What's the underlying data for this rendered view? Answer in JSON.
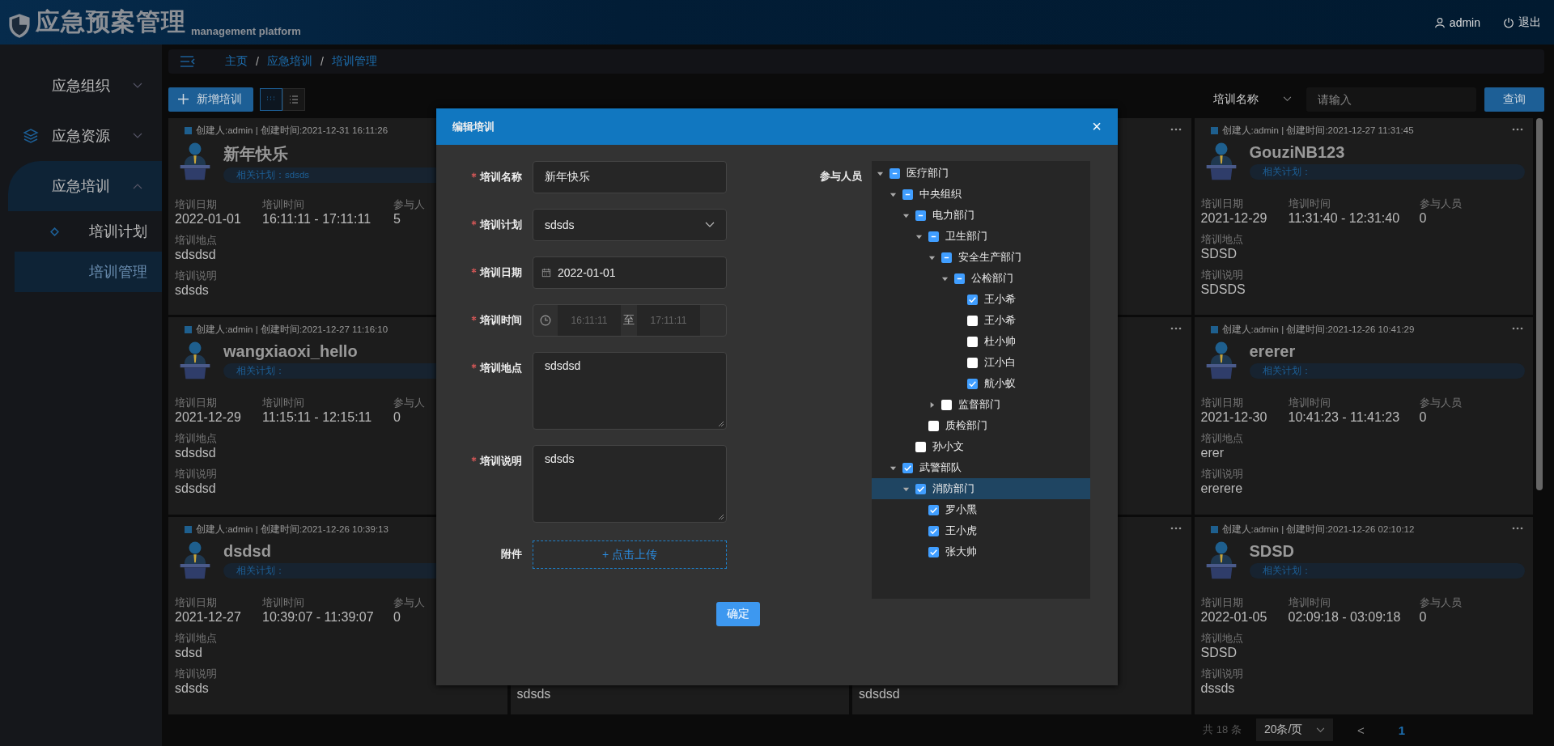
{
  "header": {
    "title": "应急预案管理",
    "subtitle": "management platform",
    "user": "admin",
    "logout": "退出"
  },
  "sidebar": {
    "items": [
      {
        "label": "应急组织",
        "icon": false,
        "expanded": false,
        "selected": false
      },
      {
        "label": "应急资源",
        "icon": true,
        "expanded": false,
        "selected": false
      },
      {
        "label": "应急培训",
        "icon": false,
        "expanded": true,
        "selected": true,
        "children": [
          {
            "label": "培训计划",
            "selected": false
          },
          {
            "label": "培训管理",
            "selected": true
          }
        ]
      }
    ]
  },
  "breadcrumb": {
    "separator": "/",
    "items": [
      "主页",
      "应急培训",
      "培训管理"
    ]
  },
  "toolbar": {
    "add_button": "新增培训",
    "views": [
      {
        "kind": "grid",
        "selected": true
      },
      {
        "kind": "list",
        "selected": false
      }
    ],
    "filter_field": "培训名称",
    "search": {
      "placeholder": "请输入"
    },
    "query_button": "查询"
  },
  "card_columns": [
    [
      {
        "meta": "创建人:admin | 创建时间:2021-12-31 16:11:26",
        "title": "新年快乐",
        "plan": "相关计划：sdsds",
        "stats": [
          {
            "label": "培训日期",
            "value": "2022-01-01"
          },
          {
            "label": "培训时间",
            "value": "16:11:11 - 17:11:11"
          },
          {
            "label": "参与人",
            "value": "5"
          }
        ],
        "place_label": "培训地点",
        "place": "sdsdsd",
        "desc_label": "培训说明",
        "desc": "sdsds"
      },
      {
        "meta": "创建人:admin | 创建时间:2021-12-27 11:16:10",
        "title": "wangxiaoxi_hello",
        "plan": "相关计划：",
        "stats": [
          {
            "label": "培训日期",
            "value": "2021-12-29"
          },
          {
            "label": "培训时间",
            "value": "11:15:11 - 12:15:11"
          },
          {
            "label": "参与人",
            "value": "0"
          }
        ],
        "place_label": "培训地点",
        "place": "sdsdsd",
        "desc_label": "培训说明",
        "desc": "sdsdsd"
      },
      {
        "meta": "创建人:admin | 创建时间:2021-12-26 10:39:13",
        "title": "dsdsd",
        "plan": "相关计划：",
        "stats": [
          {
            "label": "培训日期",
            "value": "2021-12-27"
          },
          {
            "label": "培训时间",
            "value": "10:39:07 - 11:39:07"
          },
          {
            "label": "参与人",
            "value": "0"
          }
        ],
        "place_label": "培训地点",
        "place": "sdsd",
        "desc_label": "培训说明",
        "desc": "sdsds"
      }
    ],
    [
      {
        "desc": "sdsds"
      }
    ],
    [
      {
        "menu": true
      },
      {
        "menu": true
      },
      {
        "desc": "sdsdsd",
        "menu": true
      }
    ],
    [
      {
        "meta": "创建人:admin | 创建时间:2021-12-27 11:31:45",
        "title": "GouziNB123",
        "plan": "相关计划：",
        "stats": [
          {
            "label": "培训日期",
            "value": "2021-12-29"
          },
          {
            "label": "培训时间",
            "value": "11:31:40 - 12:31:40"
          },
          {
            "label": "参与人员",
            "value": "0"
          }
        ],
        "place_label": "培训地点",
        "place": "SDSD",
        "desc_label": "培训说明",
        "desc": "SDSDS",
        "menu": true
      },
      {
        "meta": "创建人:admin | 创建时间:2021-12-26 10:41:29",
        "title": "ererer",
        "plan": "相关计划：",
        "stats": [
          {
            "label": "培训日期",
            "value": "2021-12-30"
          },
          {
            "label": "培训时间",
            "value": "10:41:23 - 11:41:23"
          },
          {
            "label": "参与人员",
            "value": "0"
          }
        ],
        "place_label": "培训地点",
        "place": "erer",
        "desc_label": "培训说明",
        "desc": "ererere",
        "menu": true
      },
      {
        "meta": "创建人:admin | 创建时间:2021-12-26 02:10:12",
        "title": "SDSD",
        "plan": "相关计划：",
        "stats": [
          {
            "label": "培训日期",
            "value": "2022-01-05"
          },
          {
            "label": "培训时间",
            "value": "02:09:18 - 03:09:18"
          },
          {
            "label": "参与人员",
            "value": "0"
          }
        ],
        "place_label": "培训地点",
        "place": "SDSD",
        "desc_label": "培训说明",
        "desc": "dssds",
        "menu": true
      }
    ]
  ],
  "pagination": {
    "total": "共 18 条",
    "page_size": "20条/页",
    "prev": "<",
    "pages": [
      {
        "label": "1",
        "selected": true
      }
    ]
  },
  "dialog": {
    "title": "编辑培训",
    "close": "×",
    "fields": [
      {
        "kind": "text",
        "label": "培训名称",
        "required": true,
        "value": "新年快乐"
      },
      {
        "kind": "select",
        "label": "培训计划",
        "required": true,
        "value": "sdsds"
      },
      {
        "kind": "date",
        "label": "培训日期",
        "required": true,
        "value": "2022-01-01"
      },
      {
        "kind": "timerange",
        "label": "培训时间",
        "required": true,
        "start": "16:11:11",
        "separator": "至",
        "end": "17:11:11"
      },
      {
        "kind": "textarea",
        "label": "培训地点",
        "required": true,
        "value": "sdsdsd"
      },
      {
        "kind": "textarea",
        "label": "培训说明",
        "required": true,
        "value": "sdsds"
      },
      {
        "kind": "upload",
        "label": "附件",
        "required": false,
        "value": "+ 点击上传"
      }
    ],
    "tree_label": "参与人员",
    "tree": [
      {
        "label": "医疗部门",
        "checked": false,
        "indeterminate": true,
        "expanded": true,
        "selected": false,
        "children": [
          {
            "label": "中央组织",
            "checked": false,
            "indeterminate": true,
            "expanded": true,
            "selected": false,
            "children": [
              {
                "label": "电力部门",
                "checked": false,
                "indeterminate": true,
                "expanded": true,
                "selected": false,
                "children": [
                  {
                    "label": "卫生部门",
                    "checked": false,
                    "indeterminate": true,
                    "expanded": true,
                    "selected": false,
                    "children": [
                      {
                        "label": "安全生产部门",
                        "checked": false,
                        "indeterminate": true,
                        "expanded": true,
                        "selected": false,
                        "children": [
                          {
                            "label": "公检部门",
                            "checked": false,
                            "indeterminate": true,
                            "expanded": true,
                            "selected": false,
                            "children": [
                              {
                                "label": "王小希",
                                "checked": true,
                                "indeterminate": false,
                                "selected": false
                              },
                              {
                                "label": "王小希",
                                "checked": false,
                                "indeterminate": false,
                                "selected": false
                              },
                              {
                                "label": "杜小帅",
                                "checked": false,
                                "indeterminate": false,
                                "selected": false
                              },
                              {
                                "label": "江小白",
                                "checked": false,
                                "indeterminate": false,
                                "selected": false
                              },
                              {
                                "label": "航小蚁",
                                "checked": true,
                                "indeterminate": false,
                                "selected": false
                              }
                            ]
                          }
                        ]
                      },
                      {
                        "label": "监督部门",
                        "checked": false,
                        "indeterminate": false,
                        "expanded": false,
                        "selected": false
                      }
                    ]
                  },
                  {
                    "label": "质检部门",
                    "checked": false,
                    "indeterminate": false,
                    "selected": false
                  }
                ]
              },
              {
                "label": "孙小文",
                "checked": false,
                "indeterminate": false,
                "selected": false
              }
            ]
          },
          {
            "label": "武警部队",
            "checked": true,
            "indeterminate": false,
            "expanded": true,
            "selected": false,
            "children": [
              {
                "label": "消防部门",
                "checked": true,
                "indeterminate": false,
                "expanded": true,
                "selected": true,
                "children": [
                  {
                    "label": "罗小黑",
                    "checked": true,
                    "indeterminate": false,
                    "selected": false
                  },
                  {
                    "label": "王小虎",
                    "checked": true,
                    "indeterminate": false,
                    "selected": false
                  },
                  {
                    "label": "张大帅",
                    "checked": true,
                    "indeterminate": false,
                    "selected": false
                  }
                ]
              }
            ]
          }
        ]
      }
    ],
    "confirm_button": "确定"
  }
}
